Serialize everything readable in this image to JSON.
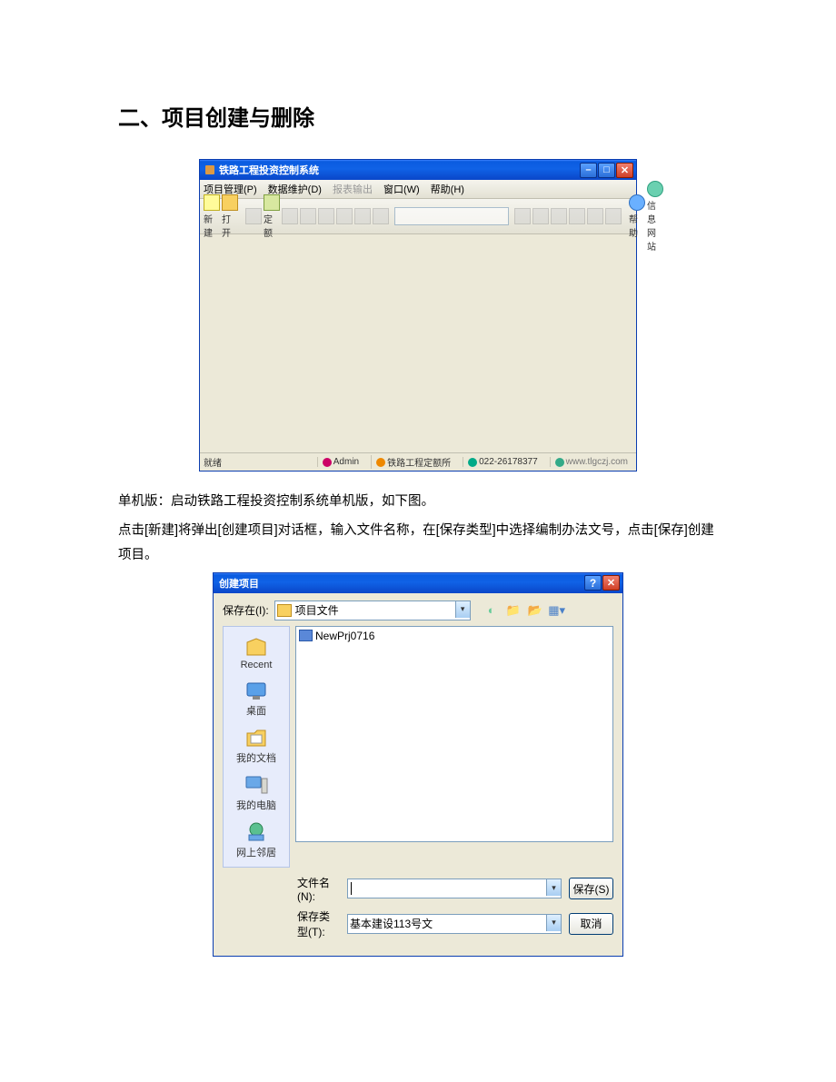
{
  "section_title": "二、项目创建与删除",
  "paragraph1": "单机版：启动铁路工程投资控制系统单机版，如下图。",
  "paragraph2": "点击[新建]将弹出[创建项目]对话框，输入文件名称，在[保存类型]中选择编制办法文号，点击[保存]创建项目。",
  "app": {
    "title": "铁路工程投资控制系统",
    "menus": [
      "项目管理(P)",
      "数据维护(D)",
      "报表输出",
      "窗口(W)",
      "帮助(H)"
    ],
    "menus_disabled_index": 2,
    "tools": [
      {
        "label": "新建",
        "enabled": true
      },
      {
        "label": "打开",
        "enabled": true
      },
      {
        "label": "",
        "enabled": false,
        "sep": true
      },
      {
        "label": "定额",
        "enabled": true
      },
      {
        "label": "",
        "enabled": false
      },
      {
        "label": "",
        "enabled": false
      },
      {
        "label": "",
        "enabled": false
      },
      {
        "label": "",
        "enabled": false
      },
      {
        "label": "",
        "enabled": false
      },
      {
        "label": "",
        "enabled": false
      },
      {
        "label": "",
        "enabled": false,
        "combo": true
      },
      {
        "label": "",
        "enabled": false
      },
      {
        "label": "",
        "enabled": false
      },
      {
        "label": "",
        "enabled": false
      },
      {
        "label": "",
        "enabled": false
      },
      {
        "label": "",
        "enabled": false
      },
      {
        "label": "",
        "enabled": false
      },
      {
        "label": "",
        "enabled": false
      },
      {
        "label": "帮助",
        "enabled": true
      },
      {
        "label": "信息网站",
        "enabled": true
      }
    ],
    "status_ready": "就绪",
    "status_user": "Admin",
    "status_org": "铁路工程定额所",
    "status_phone": "022-26178377",
    "status_url": "www.tlgczj.com"
  },
  "dialog": {
    "title": "创建项目",
    "save_in_label": "保存在(I):",
    "save_in_value": "项目文件",
    "file_item": "NewPrj0716",
    "places": [
      "Recent",
      "桌面",
      "我的文档",
      "我的电脑",
      "网上邻居"
    ],
    "filename_label": "文件名(N):",
    "filename_value": "",
    "filetype_label": "保存类型(T):",
    "filetype_value": "基本建设113号文",
    "btn_save": "保存(S)",
    "btn_cancel": "取消"
  }
}
